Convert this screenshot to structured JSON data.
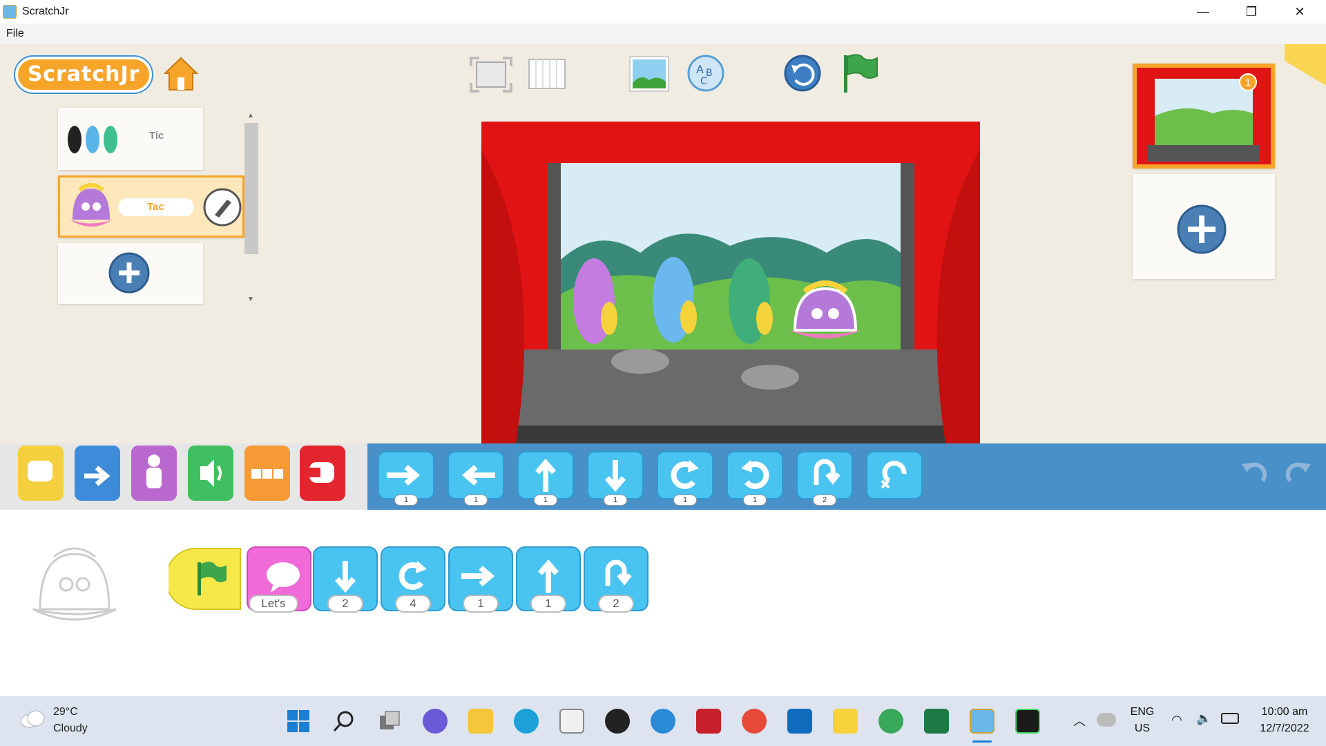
{
  "window": {
    "title": "ScratchJr",
    "minimize_glyph": "—",
    "restore_glyph": "❐",
    "close_glyph": "✕"
  },
  "menu": {
    "file_label": "File"
  },
  "toolbar": {
    "logo_text": "ScratchJr",
    "icons": [
      "home-icon",
      "fullscreen-icon",
      "grid-icon",
      "background-icon",
      "text-icon",
      "reset-icon",
      "green-flag-icon"
    ]
  },
  "sprites": [
    {
      "name": "Tic",
      "selected": false
    },
    {
      "name": "Tac",
      "selected": true
    }
  ],
  "colors": {
    "paper": "#f0ece2",
    "blue_bar": "#4a90c8",
    "stage_red": "#e01414",
    "block_blue": "#49c3f0",
    "taskbar": "#dde4ef"
  },
  "categories": [
    {
      "name": "triggering",
      "color": "#f4d03f"
    },
    {
      "name": "motion",
      "color": "#3d8bd9"
    },
    {
      "name": "looks",
      "color": "#b968d0"
    },
    {
      "name": "sound",
      "color": "#3fbf5f"
    },
    {
      "name": "control",
      "color": "#f59a35"
    },
    {
      "name": "end",
      "color": "#e3262e"
    }
  ],
  "palette_blocks": [
    {
      "icon": "move-right-icon",
      "num": "1"
    },
    {
      "icon": "move-left-icon",
      "num": "1"
    },
    {
      "icon": "move-up-icon",
      "num": "1"
    },
    {
      "icon": "move-down-icon",
      "num": "1"
    },
    {
      "icon": "turn-right-icon",
      "num": "1"
    },
    {
      "icon": "turn-left-icon",
      "num": "1"
    },
    {
      "icon": "hop-icon",
      "num": "2"
    },
    {
      "icon": "go-home-icon",
      "num": ""
    }
  ],
  "script": {
    "say_text": "Let's",
    "blocks": [
      {
        "icon": "green-flag-icon",
        "num": ""
      },
      {
        "icon": "say-icon",
        "num": ""
      },
      {
        "icon": "move-down-icon",
        "num": "2"
      },
      {
        "icon": "turn-right-icon",
        "num": "4"
      },
      {
        "icon": "move-right-icon",
        "num": "1"
      },
      {
        "icon": "move-up-icon",
        "num": "1"
      },
      {
        "icon": "hop-icon",
        "num": "2"
      }
    ]
  },
  "taskbar": {
    "temperature": "29°C",
    "condition": "Cloudy",
    "language": "ENG",
    "region": "US",
    "time": "10:00 am",
    "date": "12/7/2022"
  }
}
